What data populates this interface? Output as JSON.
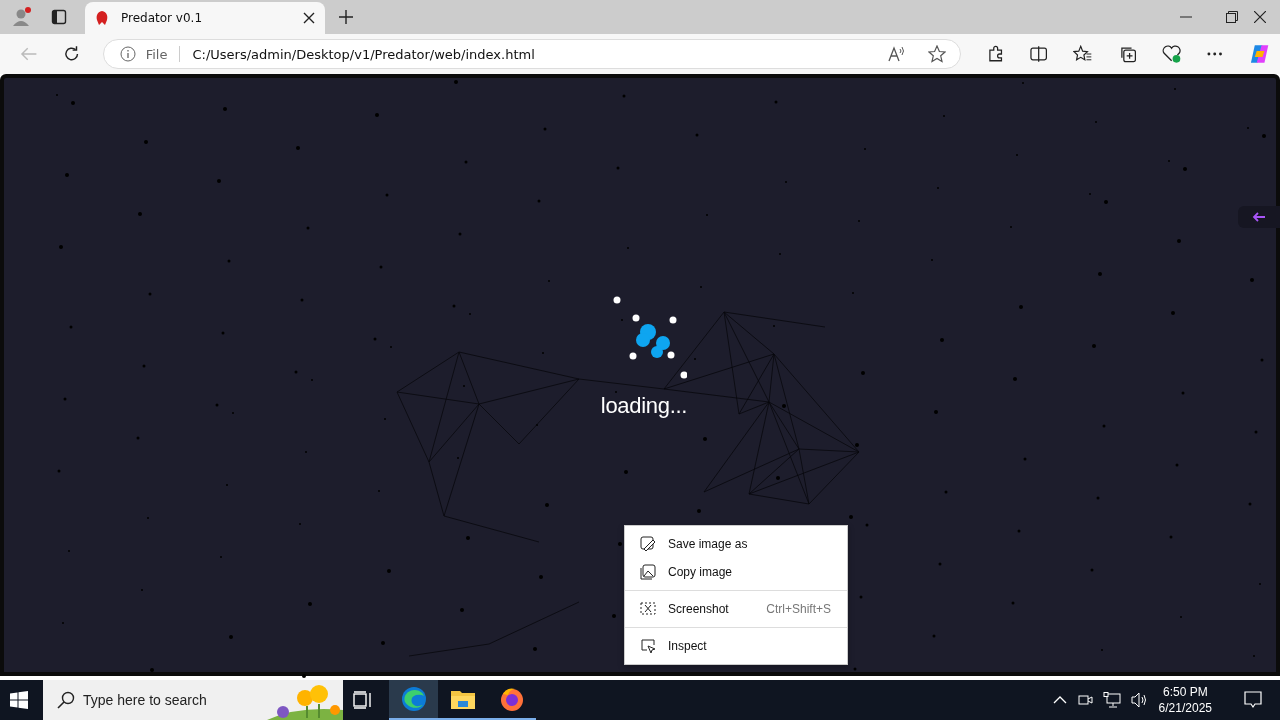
{
  "browser": {
    "tabs": [
      {
        "title": "Predator v0.1",
        "selected": true
      }
    ],
    "address": {
      "scheme": "File",
      "url": "C:/Users/admin/Desktop/v1/Predator/web/index.html"
    }
  },
  "page": {
    "status": "loading...",
    "side_panel": {
      "expanded": false
    }
  },
  "context_menu": {
    "groups": [
      [
        {
          "label": "Save image as",
          "kind": "save"
        },
        {
          "label": "Copy image",
          "kind": "copy"
        }
      ],
      [
        {
          "label": "Screenshot",
          "kind": "screenshot",
          "shortcut": "Ctrl+Shift+S"
        }
      ],
      [
        {
          "label": "Inspect",
          "kind": "inspect"
        }
      ]
    ]
  },
  "taskbar": {
    "search": {
      "placeholder": "Type here to search"
    },
    "apps": [
      {
        "kind": "edge",
        "selected": true
      },
      {
        "kind": "explorer",
        "selected": false
      },
      {
        "kind": "firefox",
        "selected": false
      }
    ],
    "time": "6:50 PM",
    "date": "6/21/2025"
  }
}
